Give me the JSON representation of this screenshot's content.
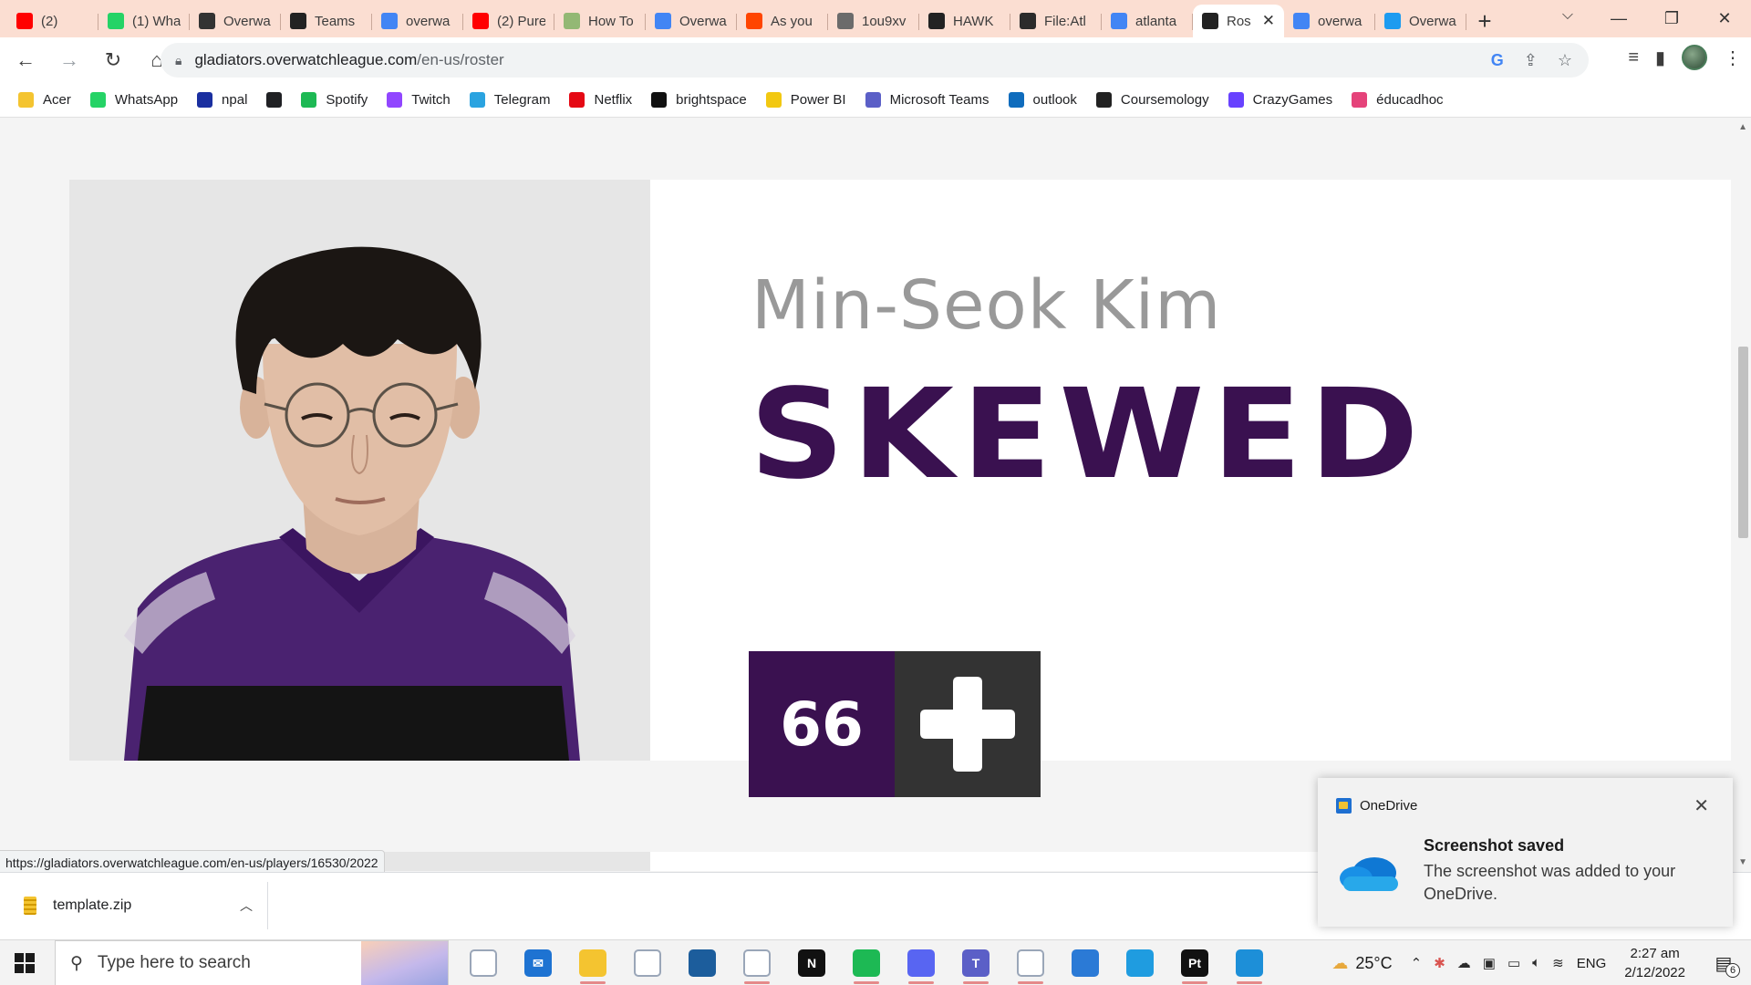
{
  "browser": {
    "tabs": [
      {
        "label": "(2)",
        "icon": "youtube-icon",
        "color": "#ff0000"
      },
      {
        "label": "(1) Wha",
        "icon": "whatsapp-icon",
        "color": "#25d366"
      },
      {
        "label": "Overwa",
        "icon": "overwatch-icon",
        "color": "#333333"
      },
      {
        "label": "Teams",
        "icon": "overwatch-league-icon",
        "color": "#222222"
      },
      {
        "label": "overwa",
        "icon": "google-icon",
        "color": "#4285f4"
      },
      {
        "label": "(2) Pure",
        "icon": "youtube-icon",
        "color": "#ff0000"
      },
      {
        "label": "How To",
        "icon": "wikihow-icon",
        "color": "#93b874"
      },
      {
        "label": "Overwa",
        "icon": "google-icon",
        "color": "#4285f4"
      },
      {
        "label": "As you",
        "icon": "reddit-icon",
        "color": "#ff4500"
      },
      {
        "label": "1ou9xv",
        "icon": "globe-icon",
        "color": "#6b6b6b"
      },
      {
        "label": "HAWK",
        "icon": "overwatch-league-icon",
        "color": "#222222"
      },
      {
        "label": "File:Atl",
        "icon": "wiki-icon",
        "color": "#2b2b2b"
      },
      {
        "label": "atlanta",
        "icon": "google-icon",
        "color": "#4285f4"
      },
      {
        "label": "Ros",
        "icon": "overwatch-league-icon",
        "color": "#222222",
        "active": true
      },
      {
        "label": "overwa",
        "icon": "google-icon",
        "color": "#4285f4"
      },
      {
        "label": "Overwa",
        "icon": "twitter-icon",
        "color": "#1d9bf0"
      }
    ],
    "url_host": "gladiators.overwatchleague.com",
    "url_path": "/en-us/roster",
    "bookmarks": [
      {
        "label": "Acer",
        "icon": "folder-icon",
        "color": "#f4c430"
      },
      {
        "label": "WhatsApp",
        "icon": "whatsapp-icon",
        "color": "#25d366"
      },
      {
        "label": "npal",
        "icon": "npal-icon",
        "color": "#1a2fa0"
      },
      {
        "label": "",
        "icon": "globe-icon",
        "color": "#202124"
      },
      {
        "label": "Spotify",
        "icon": "spotify-icon",
        "color": "#1db954"
      },
      {
        "label": "Twitch",
        "icon": "twitch-icon",
        "color": "#9146ff"
      },
      {
        "label": "Telegram",
        "icon": "telegram-icon",
        "color": "#2aa3e0"
      },
      {
        "label": "Netflix",
        "icon": "netflix-icon",
        "color": "#e50914"
      },
      {
        "label": "brightspace",
        "icon": "np-icon",
        "color": "#111111"
      },
      {
        "label": "Power BI",
        "icon": "powerbi-icon",
        "color": "#f2c811"
      },
      {
        "label": "Microsoft Teams",
        "icon": "teams-icon",
        "color": "#5b5fc7"
      },
      {
        "label": "outlook",
        "icon": "outlook-icon",
        "color": "#0f6cbd"
      },
      {
        "label": "Coursemology",
        "icon": "coursemology-icon",
        "color": "#222222"
      },
      {
        "label": "CrazyGames",
        "icon": "crazygames-icon",
        "color": "#6842ff"
      },
      {
        "label": "éducadhoc",
        "icon": "educadhoc-icon",
        "color": "#e5437a"
      }
    ],
    "status_url": "https://gladiators.overwatchleague.com/en-us/players/16530/2022"
  },
  "player": {
    "full_name": "Min-Seok Kim",
    "handle": "SKEWED",
    "number": "66",
    "role_icon": "support-plus-icon",
    "team_color": "#3a1150",
    "role_bg": "#333333"
  },
  "download": {
    "file_name": "template.zip"
  },
  "toast": {
    "app": "OneDrive",
    "title": "Screenshot saved",
    "body": "The screenshot was added to your OneDrive."
  },
  "taskbar": {
    "search_placeholder": "Type here to search",
    "apps": [
      {
        "icon": "task-view-icon",
        "color": "#ffffff",
        "glyph": "",
        "running": false
      },
      {
        "icon": "mail-icon",
        "color": "#1e73d2",
        "glyph": "✉",
        "running": false
      },
      {
        "icon": "file-explorer-icon",
        "color": "#f4c430",
        "glyph": "",
        "running": true
      },
      {
        "icon": "dropbox-icon",
        "color": "#ffffff",
        "glyph": "",
        "running": false
      },
      {
        "icon": "cursor-app-icon",
        "color": "#1c5d9c",
        "glyph": "",
        "running": false
      },
      {
        "icon": "chrome-icon",
        "color": "#ffffff",
        "glyph": "",
        "running": true
      },
      {
        "icon": "netflix-icon",
        "color": "#111111",
        "glyph": "N",
        "running": false
      },
      {
        "icon": "spotify-icon",
        "color": "#1db954",
        "glyph": "",
        "running": true
      },
      {
        "icon": "discord-icon",
        "color": "#5865f2",
        "glyph": "",
        "running": true
      },
      {
        "icon": "teams-icon",
        "color": "#5b5fc7",
        "glyph": "T",
        "running": true
      },
      {
        "icon": "vscode-icon",
        "color": "#ffffff",
        "glyph": "",
        "running": true
      },
      {
        "icon": "photos-icon",
        "color": "#2b7ad6",
        "glyph": "",
        "running": false
      },
      {
        "icon": "edge-icon",
        "color": "#1f9ce0",
        "glyph": "",
        "running": false
      },
      {
        "icon": "pycharm-icon",
        "color": "#111111",
        "glyph": "Pt",
        "running": true
      },
      {
        "icon": "edge-dev-icon",
        "color": "#1d8fd8",
        "glyph": "",
        "running": true
      }
    ],
    "temperature": "25°C",
    "language": "ENG",
    "time": "2:27 am",
    "date": "2/12/2022",
    "notification_count": "6"
  }
}
